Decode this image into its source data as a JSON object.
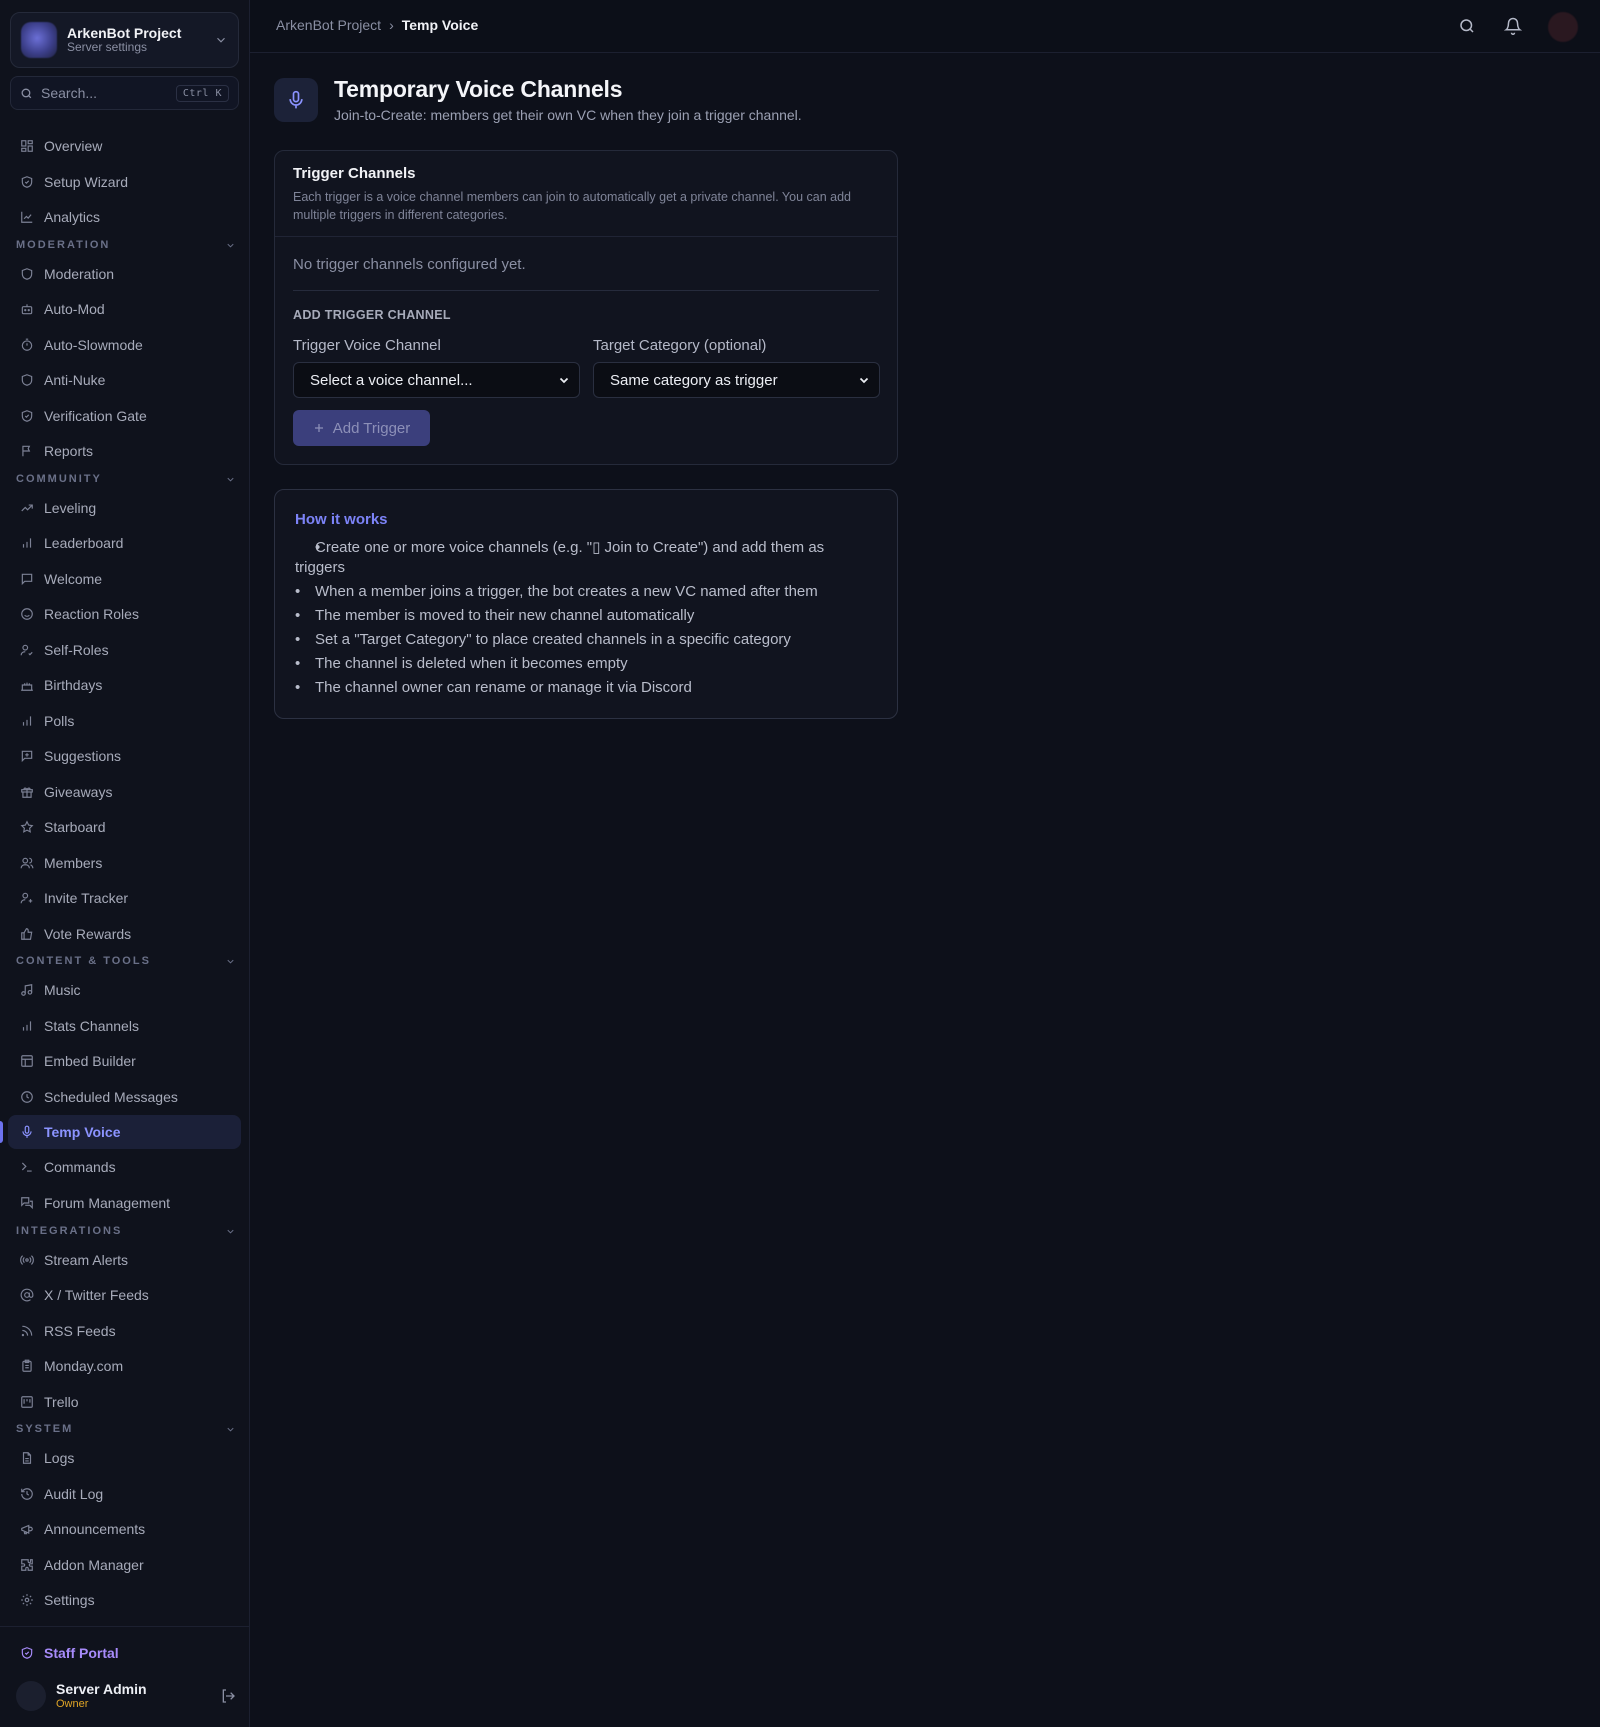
{
  "server": {
    "name": "ArkenBot Project",
    "subtitle": "Server settings"
  },
  "search": {
    "placeholder": "Search...",
    "shortcut": "Ctrl K"
  },
  "sidebar": {
    "top": [
      "Overview",
      "Setup Wizard",
      "Analytics"
    ],
    "sections": [
      {
        "title": "MODERATION",
        "items": [
          "Moderation",
          "Auto-Mod",
          "Auto-Slowmode",
          "Anti-Nuke",
          "Verification Gate",
          "Reports"
        ]
      },
      {
        "title": "COMMUNITY",
        "items": [
          "Leveling",
          "Leaderboard",
          "Welcome",
          "Reaction Roles",
          "Self-Roles",
          "Birthdays",
          "Polls",
          "Suggestions",
          "Giveaways",
          "Starboard",
          "Members",
          "Invite Tracker",
          "Vote Rewards"
        ]
      },
      {
        "title": "CONTENT & TOOLS",
        "items": [
          "Music",
          "Stats Channels",
          "Embed Builder",
          "Scheduled Messages",
          "Temp Voice",
          "Commands",
          "Forum Management"
        ]
      },
      {
        "title": "INTEGRATIONS",
        "items": [
          "Stream Alerts",
          "X / Twitter Feeds",
          "RSS Feeds",
          "Monday.com",
          "Trello"
        ]
      },
      {
        "title": "SYSTEM",
        "items": [
          "Logs",
          "Audit Log",
          "Announcements",
          "Addon Manager",
          "Settings"
        ]
      }
    ],
    "active": "Temp Voice",
    "staff_portal": "Staff Portal",
    "user": {
      "name": "Server Admin",
      "role": "Owner"
    }
  },
  "breadcrumb": {
    "parent": "ArkenBot Project",
    "separator": "›",
    "current": "Temp Voice"
  },
  "page": {
    "title": "Temporary Voice Channels",
    "subtitle": "Join-to-Create: members get their own VC when they join a trigger channel."
  },
  "trigger_card": {
    "title": "Trigger Channels",
    "description": "Each trigger is a voice channel members can join to automatically get a private channel. You can add multiple triggers in different categories.",
    "empty_text": "No trigger channels configured yet.",
    "add_heading": "ADD TRIGGER CHANNEL",
    "trigger_label": "Trigger Voice Channel",
    "trigger_value": "Select a voice channel...",
    "category_label": "Target Category (optional)",
    "category_value": "Same category as trigger",
    "add_button": "Add Trigger"
  },
  "how_it_works": {
    "title": "How it works",
    "items": [
      "Create one or more voice channels (e.g. \"▯ Join to Create\") and add them as triggers",
      "When a member joins a trigger, the bot creates a new VC named after them",
      "The member is moved to their new channel automatically",
      "Set a \"Target Category\" to place created channels in a specific category",
      "The channel is deleted when it becomes empty",
      "The channel owner can rename or manage it via Discord"
    ]
  },
  "colors": {
    "accent": "#8b93ff",
    "background": "#0d101a",
    "owner": "#e0a526",
    "staff": "#a78bfa"
  }
}
